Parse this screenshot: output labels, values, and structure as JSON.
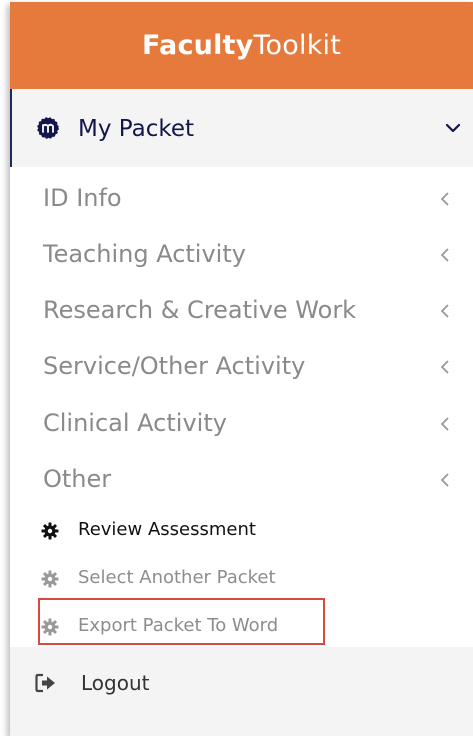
{
  "header": {
    "brand_bold": "Faculty",
    "brand_light": "Toolkit"
  },
  "packet": {
    "label": "My Packet",
    "icon": "packet-logo-icon",
    "expand_icon": "chevron-down-icon"
  },
  "menu": {
    "items": [
      {
        "label": "ID Info",
        "icon": "chevron-left-icon"
      },
      {
        "label": "Teaching Activity",
        "icon": "chevron-left-icon"
      },
      {
        "label": "Research & Creative Work",
        "icon": "chevron-left-icon"
      },
      {
        "label": "Service/Other Activity",
        "icon": "chevron-left-icon"
      },
      {
        "label": "Clinical Activity",
        "icon": "chevron-left-icon"
      },
      {
        "label": "Other",
        "icon": "chevron-left-icon"
      }
    ],
    "subitems": [
      {
        "label": "Review Assessment",
        "icon": "gear-icon"
      },
      {
        "label": "Select Another Packet",
        "icon": "gear-icon"
      },
      {
        "label": "Export Packet To Word",
        "icon": "gear-icon"
      }
    ]
  },
  "logout": {
    "label": "Logout",
    "icon": "sign-out-icon"
  },
  "colors": {
    "header": "#e57a3c",
    "navy": "#12164d",
    "highlight_border": "#d64a3f",
    "panel_bg": "#f4f4f4"
  }
}
